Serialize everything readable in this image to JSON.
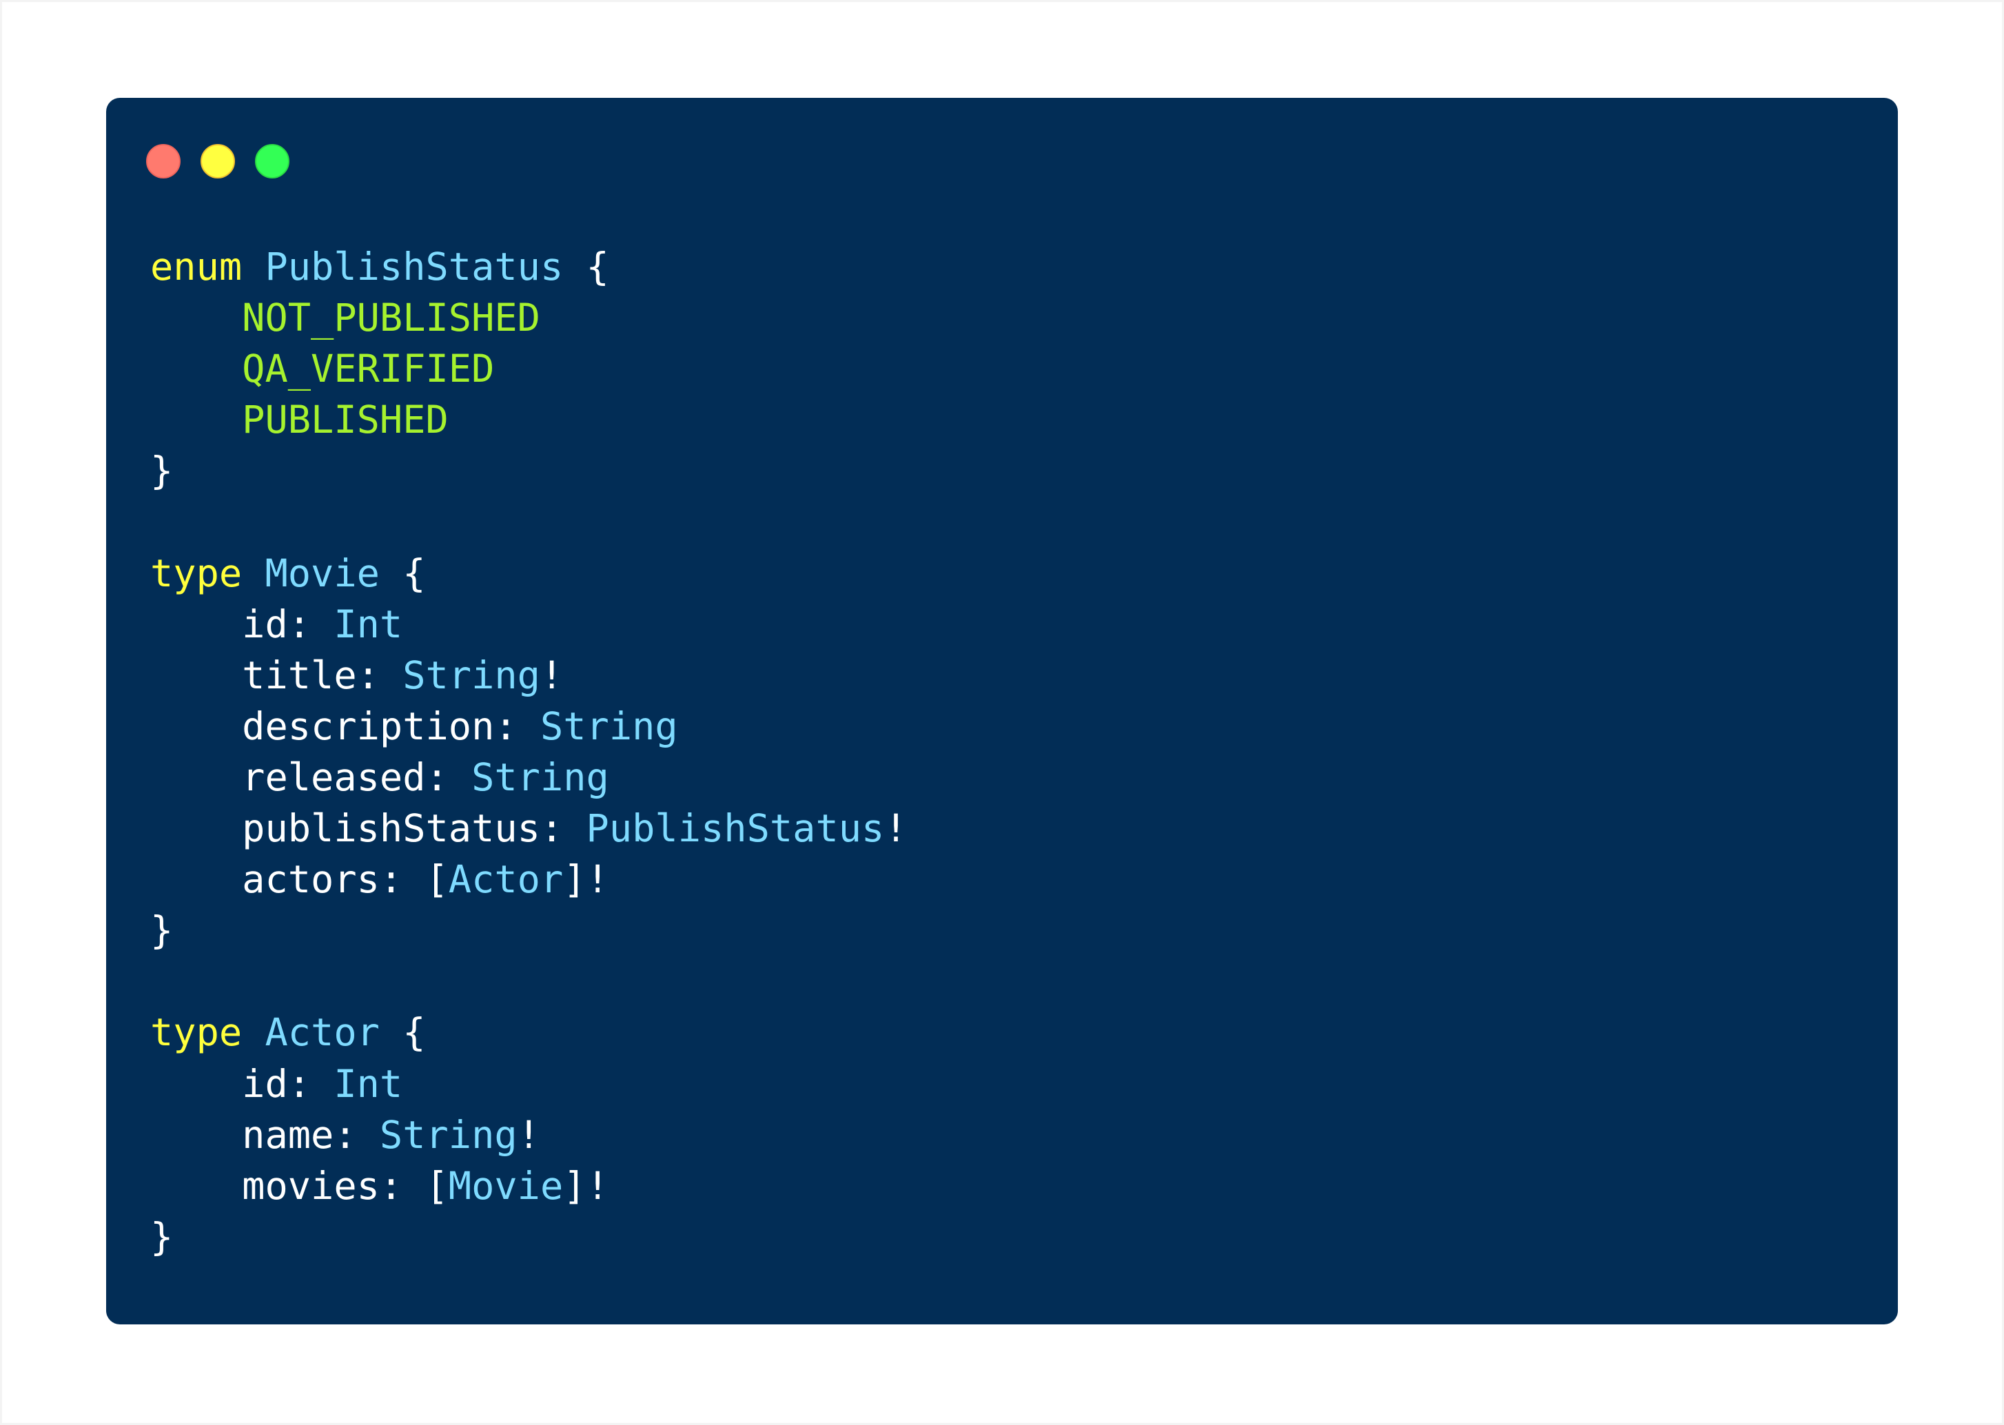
{
  "window": {
    "controls": [
      {
        "name": "close",
        "color": "#ff7a6e"
      },
      {
        "name": "minimize",
        "color": "#ffff40"
      },
      {
        "name": "maximize",
        "color": "#33ff55"
      }
    ],
    "background": "#022d56"
  },
  "colors": {
    "keyword": "#ffff3c",
    "type_name": "#7fdbff",
    "enum_value": "#a6f22e",
    "plain": "#ffffff"
  },
  "code": {
    "indent": "    ",
    "lines": [
      [
        {
          "t": "kw",
          "v": "enum"
        },
        {
          "t": "pn",
          "v": " "
        },
        {
          "t": "tn",
          "v": "PublishStatus"
        },
        {
          "t": "pn",
          "v": " {"
        }
      ],
      [
        {
          "t": "pn",
          "v": "    "
        },
        {
          "t": "ev",
          "v": "NOT_PUBLISHED"
        }
      ],
      [
        {
          "t": "pn",
          "v": "    "
        },
        {
          "t": "ev",
          "v": "QA_VERIFIED"
        }
      ],
      [
        {
          "t": "pn",
          "v": "    "
        },
        {
          "t": "ev",
          "v": "PUBLISHED"
        }
      ],
      [
        {
          "t": "pn",
          "v": "}"
        }
      ],
      [],
      [
        {
          "t": "kw",
          "v": "type"
        },
        {
          "t": "pn",
          "v": " "
        },
        {
          "t": "tn",
          "v": "Movie"
        },
        {
          "t": "pn",
          "v": " {"
        }
      ],
      [
        {
          "t": "pn",
          "v": "    id: "
        },
        {
          "t": "tn",
          "v": "Int"
        }
      ],
      [
        {
          "t": "pn",
          "v": "    title: "
        },
        {
          "t": "tn",
          "v": "String"
        },
        {
          "t": "pn",
          "v": "!"
        }
      ],
      [
        {
          "t": "pn",
          "v": "    description: "
        },
        {
          "t": "tn",
          "v": "String"
        }
      ],
      [
        {
          "t": "pn",
          "v": "    released: "
        },
        {
          "t": "tn",
          "v": "String"
        }
      ],
      [
        {
          "t": "pn",
          "v": "    publishStatus: "
        },
        {
          "t": "tn",
          "v": "PublishStatus"
        },
        {
          "t": "pn",
          "v": "!"
        }
      ],
      [
        {
          "t": "pn",
          "v": "    actors: ["
        },
        {
          "t": "tn",
          "v": "Actor"
        },
        {
          "t": "pn",
          "v": "]!"
        }
      ],
      [
        {
          "t": "pn",
          "v": "}"
        }
      ],
      [],
      [
        {
          "t": "kw",
          "v": "type"
        },
        {
          "t": "pn",
          "v": " "
        },
        {
          "t": "tn",
          "v": "Actor"
        },
        {
          "t": "pn",
          "v": " {"
        }
      ],
      [
        {
          "t": "pn",
          "v": "    id: "
        },
        {
          "t": "tn",
          "v": "Int"
        }
      ],
      [
        {
          "t": "pn",
          "v": "    name: "
        },
        {
          "t": "tn",
          "v": "String"
        },
        {
          "t": "pn",
          "v": "!"
        }
      ],
      [
        {
          "t": "pn",
          "v": "    movies: ["
        },
        {
          "t": "tn",
          "v": "Movie"
        },
        {
          "t": "pn",
          "v": "]!"
        }
      ],
      [
        {
          "t": "pn",
          "v": "}"
        }
      ]
    ]
  }
}
